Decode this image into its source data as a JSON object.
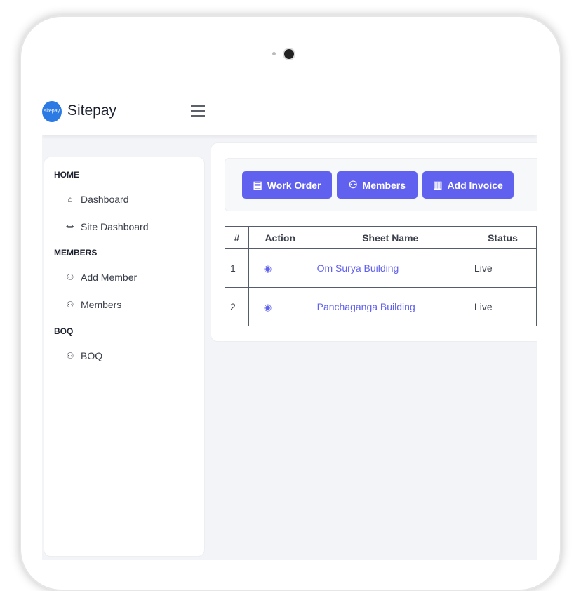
{
  "app": {
    "brand": "Sitepay",
    "logo_text": "sitepay"
  },
  "sidebar": {
    "sections": [
      {
        "title": "HOME",
        "items": [
          {
            "label": "Dashboard",
            "icon": "home-icon"
          },
          {
            "label": "Site Dashboard",
            "icon": "bank-icon"
          }
        ]
      },
      {
        "title": "MEMBERS",
        "items": [
          {
            "label": "Add Member",
            "icon": "user-plus-icon"
          },
          {
            "label": "Members",
            "icon": "users-icon"
          }
        ]
      },
      {
        "title": "BOQ",
        "items": [
          {
            "label": "BOQ",
            "icon": "users-icon"
          }
        ]
      }
    ]
  },
  "toolbar": {
    "work_order": "Work Order",
    "members": "Members",
    "add_invoice": "Add Invoice"
  },
  "table": {
    "headers": [
      "#",
      "Action",
      "Sheet Name",
      "Status"
    ],
    "rows": [
      {
        "num": "1",
        "name": "Om Surya Building",
        "status": "Live"
      },
      {
        "num": "2",
        "name": "Panchaganga Building",
        "status": "Live"
      }
    ]
  },
  "colors": {
    "accent": "#6161ef",
    "logo": "#2c7be5"
  }
}
